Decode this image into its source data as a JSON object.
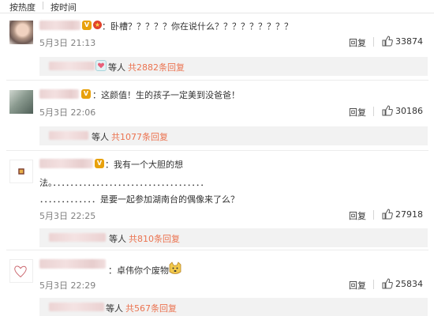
{
  "sort_tabs": [
    "按热度",
    "按时间"
  ],
  "actions": {
    "reply_label": "回复"
  },
  "comments": [
    {
      "text": "：卧槽？？？？？你在说什么？？？？？？？？？",
      "time": "5月3日 21:13",
      "likes": "33874",
      "replies": {
        "suffix": "等人",
        "link": "共2882条回复"
      }
    },
    {
      "text": "：这颜值！生的孩子一定美到没爸爸！",
      "time": "5月3日 22:06",
      "likes": "30186",
      "replies": {
        "suffix": "等人",
        "link": "共1077条回复"
      }
    },
    {
      "text_line1": "：我有一个大胆的想",
      "text_line2": "法。．．．．．．．．．．．．．．．．．．．．．．．．．．．．．．．．．．．",
      "text_line3": "．．．．．．．．．．．．．是要一起参加湖南台的偶像来了么？",
      "time": "5月3日 22:25",
      "likes": "27918",
      "replies": {
        "suffix": "等人",
        "link": "共810条回复"
      }
    },
    {
      "text": "：卓伟你个废物",
      "time": "5月3日 22:29",
      "likes": "25834",
      "replies": {
        "suffix": "等人",
        "link": "共567条回复"
      }
    }
  ],
  "colors": {
    "link": "#eb7350",
    "reply_box_bg": "#f2f2f2",
    "time_text": "#808080"
  },
  "icons": [
    "vip-crown-icon",
    "red-medal-icon",
    "thumbs-up-icon",
    "heart-emoji-icon",
    "doge-emoji-icon",
    "avatar-heart-sketch-icon",
    "avatar-logo-icon"
  ]
}
